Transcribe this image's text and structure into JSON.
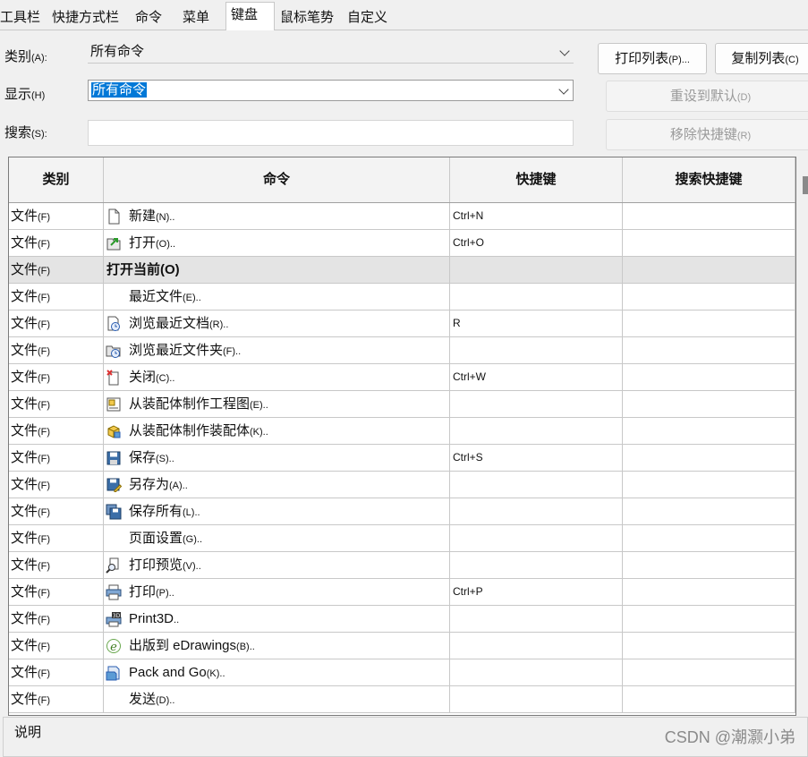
{
  "tabs": [
    "工具栏",
    "快捷方式栏",
    "命令",
    "菜单",
    "键盘",
    "鼠标笔势",
    "自定义"
  ],
  "active_tab": "键盘",
  "form": {
    "category_label": "类别",
    "category_key": "(A):",
    "category_value": "所有命令",
    "show_label": "显示",
    "show_key": "(H)",
    "show_value": "所有命令",
    "search_label": "搜索",
    "search_key": "(S):",
    "search_value": ""
  },
  "buttons": {
    "print_list": "打印列表",
    "print_list_key": "(P)...",
    "copy_list": "复制列表",
    "copy_list_key": "(C)",
    "reset_default": "重设到默认",
    "reset_default_key": "(D)",
    "remove_shortcut": "移除快捷键",
    "remove_shortcut_key": "(R)"
  },
  "table": {
    "headers": [
      "类别",
      "命令",
      "快捷键",
      "搜索快捷键"
    ],
    "rows": [
      {
        "category": "文件",
        "category_key": "(F)",
        "command": "新建",
        "command_key": "(N)..",
        "shortcut": "Ctrl+N",
        "search_shortcut": "",
        "icon": "new-document-icon",
        "bold": false
      },
      {
        "category": "文件",
        "category_key": "(F)",
        "command": "打开",
        "command_key": "(O)..",
        "shortcut": "Ctrl+O",
        "search_shortcut": "",
        "icon": "open-document-icon",
        "bold": false
      },
      {
        "category": "文件",
        "category_key": "(F)",
        "command": "打开当前",
        "command_key": "(O)",
        "shortcut": "",
        "search_shortcut": "",
        "icon": "",
        "bold": true
      },
      {
        "category": "文件",
        "category_key": "(F)",
        "command": "最近文件",
        "command_key": "(E)..",
        "shortcut": "",
        "search_shortcut": "",
        "icon": "",
        "bold": false
      },
      {
        "category": "文件",
        "category_key": "(F)",
        "command": "浏览最近文档",
        "command_key": "(R)..",
        "shortcut": "R",
        "search_shortcut": "",
        "icon": "recent-documents-icon",
        "bold": false
      },
      {
        "category": "文件",
        "category_key": "(F)",
        "command": "浏览最近文件夹",
        "command_key": "(F)..",
        "shortcut": "",
        "search_shortcut": "",
        "icon": "recent-folders-icon",
        "bold": false
      },
      {
        "category": "文件",
        "category_key": "(F)",
        "command": "关闭",
        "command_key": "(C)..",
        "shortcut": "Ctrl+W",
        "search_shortcut": "",
        "icon": "close-document-icon",
        "bold": false
      },
      {
        "category": "文件",
        "category_key": "(F)",
        "command": "从装配体制作工程图",
        "command_key": "(E)..",
        "shortcut": "",
        "search_shortcut": "",
        "icon": "make-drawing-icon",
        "bold": false
      },
      {
        "category": "文件",
        "category_key": "(F)",
        "command": "从装配体制作装配体",
        "command_key": "(K)..",
        "shortcut": "",
        "search_shortcut": "",
        "icon": "make-assembly-icon",
        "bold": false
      },
      {
        "category": "文件",
        "category_key": "(F)",
        "command": "保存",
        "command_key": "(S)..",
        "shortcut": "Ctrl+S",
        "search_shortcut": "",
        "icon": "save-icon",
        "bold": false
      },
      {
        "category": "文件",
        "category_key": "(F)",
        "command": "另存为",
        "command_key": "(A)..",
        "shortcut": "",
        "search_shortcut": "",
        "icon": "save-as-icon",
        "bold": false
      },
      {
        "category": "文件",
        "category_key": "(F)",
        "command": "保存所有",
        "command_key": "(L)..",
        "shortcut": "",
        "search_shortcut": "",
        "icon": "save-all-icon",
        "bold": false
      },
      {
        "category": "文件",
        "category_key": "(F)",
        "command": "页面设置",
        "command_key": "(G)..",
        "shortcut": "",
        "search_shortcut": "",
        "icon": "",
        "bold": false
      },
      {
        "category": "文件",
        "category_key": "(F)",
        "command": "打印预览",
        "command_key": "(V)..",
        "shortcut": "",
        "search_shortcut": "",
        "icon": "print-preview-icon",
        "bold": false
      },
      {
        "category": "文件",
        "category_key": "(F)",
        "command": "打印",
        "command_key": "(P)..",
        "shortcut": "Ctrl+P",
        "search_shortcut": "",
        "icon": "print-icon",
        "bold": false
      },
      {
        "category": "文件",
        "category_key": "(F)",
        "command": "Print3D",
        "command_key": "..",
        "shortcut": "",
        "search_shortcut": "",
        "icon": "print3d-icon",
        "bold": false
      },
      {
        "category": "文件",
        "category_key": "(F)",
        "command": "出版到 eDrawings",
        "command_key": "(B)..",
        "shortcut": "",
        "search_shortcut": "",
        "icon": "edrawings-icon",
        "bold": false
      },
      {
        "category": "文件",
        "category_key": "(F)",
        "command": "Pack and Go",
        "command_key": "(K)..",
        "shortcut": "",
        "search_shortcut": "",
        "icon": "pack-and-go-icon",
        "bold": false
      },
      {
        "category": "文件",
        "category_key": "(F)",
        "command": "发送",
        "command_key": "(D)..",
        "shortcut": "",
        "search_shortcut": "",
        "icon": "",
        "bold": false
      }
    ]
  },
  "description_label": "说明",
  "watermark": "CSDN @潮灏小弟"
}
